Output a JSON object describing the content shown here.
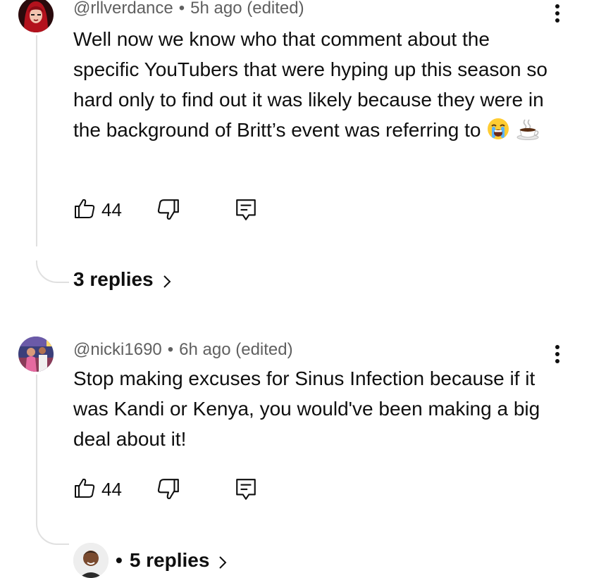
{
  "comments": [
    {
      "handle": "@rllverdance",
      "time": "5h ago (edited)",
      "text": "Well now we know who that comment about the specific YouTubers that were hyping up this season so hard only to find out it was likely because they were in the background of Britt’s event was referring to",
      "emojis": [
        "loudly-crying-face-emoji",
        "hot-beverage-emoji"
      ],
      "likes": "44",
      "replies_label": "3 replies"
    },
    {
      "handle": "@nicki1690",
      "time": "6h ago (edited)",
      "text": "Stop making excuses for Sinus Infection because if it was Kandi or Kenya, you would've been making a big deal about it!",
      "likes": "44",
      "replies_label": "5 replies"
    }
  ],
  "separator": "•",
  "icons": {
    "like": "thumbs-up-icon",
    "dislike": "thumbs-down-icon",
    "reply": "comment-reply-icon",
    "more": "more-vertical-icon",
    "chevron": "chevron-right-icon"
  },
  "colors": {
    "text": "#0f0f0f",
    "meta": "#606060",
    "thread_line": "#e0e0e0"
  }
}
